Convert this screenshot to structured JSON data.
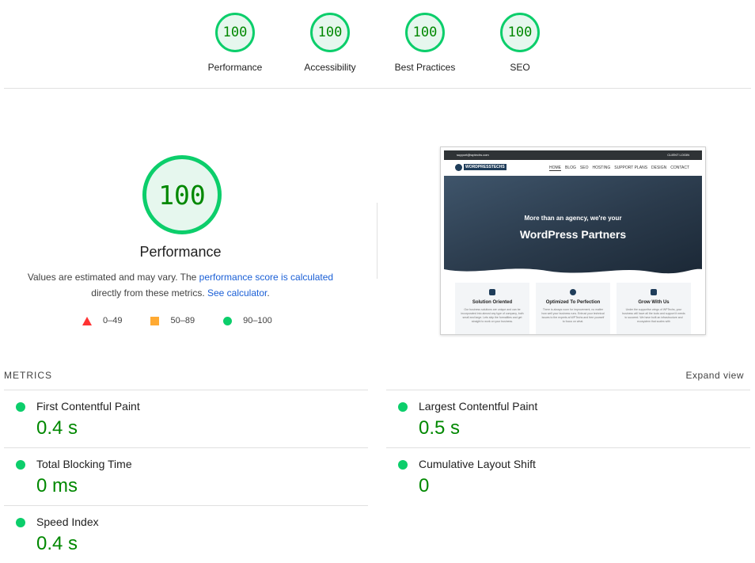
{
  "categories": [
    {
      "score": "100",
      "label": "Performance"
    },
    {
      "score": "100",
      "label": "Accessibility"
    },
    {
      "score": "100",
      "label": "Best Practices"
    },
    {
      "score": "100",
      "label": "SEO"
    }
  ],
  "performance": {
    "score": "100",
    "title": "Performance",
    "note_prefix": "Values are estimated and may vary. The ",
    "note_link1": "performance score is calculated",
    "note_middle": " directly from these metrics. ",
    "note_link2": "See calculator",
    "note_suffix": ".",
    "legend": [
      {
        "range": "0–49",
        "color": "#ff3333",
        "shape": "triangle"
      },
      {
        "range": "50–89",
        "color": "#ffaa33",
        "shape": "square"
      },
      {
        "range": "90–100",
        "color": "#0cce6b",
        "shape": "circle"
      }
    ]
  },
  "screenshot": {
    "topbar_left": "support@wptechs.com",
    "topbar_right": "CLIENT LOGIN",
    "logo_text": "WORDPRESSTECHS",
    "menu": [
      "HOME",
      "BLOG",
      "SEO",
      "HOSTING",
      "SUPPORT PLANS",
      "DESIGN",
      "CONTACT"
    ],
    "hero_line1": "More than an agency, we're your",
    "hero_line2": "WordPress Partners",
    "cards": [
      {
        "title": "Solution Oriented",
        "text": "Our business solutions are unique and can be incorporated into almost any type of company, both small and large. Lets skip the formalities and get straight to work on your business."
      },
      {
        "title": "Optimized To Perfection",
        "text": "There is always room for improvement, no matter how well your business runs. Entrust your technical issues to the experts at WPTechs and free yourself to focus on what."
      },
      {
        "title": "Grow With Us",
        "text": "Under the supportive wings of WPTechs, your business will have all the tools and support it needs to succeed. We have built an infrastructure and ecosystem that scales with"
      }
    ]
  },
  "metrics": {
    "heading": "METRICS",
    "expand_label": "Expand view",
    "items": [
      {
        "label": "First Contentful Paint",
        "value": "0.4 s"
      },
      {
        "label": "Largest Contentful Paint",
        "value": "0.5 s"
      },
      {
        "label": "Total Blocking Time",
        "value": "0 ms"
      },
      {
        "label": "Cumulative Layout Shift",
        "value": "0"
      },
      {
        "label": "Speed Index",
        "value": "0.4 s"
      }
    ]
  },
  "colors": {
    "pass": "#0cce6b",
    "pass_text": "#008800",
    "link": "#1a5fd6"
  }
}
